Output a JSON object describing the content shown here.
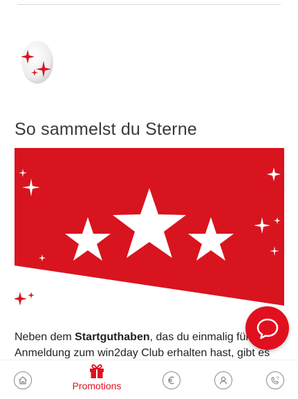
{
  "section": {
    "title": "So sammelst du Sterne"
  },
  "body": {
    "part1": "Neben dem ",
    "bold": "Startguthaben",
    "part2": ", das du einmalig für",
    "line2": "Anmeldung zum win2day Club erhalten hast, gibt es"
  },
  "chat": {
    "icon": "chat-bubble-icon"
  },
  "nav": {
    "items": [
      {
        "icon": "home-icon",
        "label": ""
      },
      {
        "icon": "gift-icon",
        "label": "Promotions"
      },
      {
        "icon": "euro-icon",
        "label": ""
      },
      {
        "icon": "user-icon",
        "label": ""
      },
      {
        "icon": "help-phone-icon",
        "label": ""
      }
    ]
  },
  "colors": {
    "brand_red": "#e0101e",
    "icon_gray": "#8a8a8a"
  }
}
